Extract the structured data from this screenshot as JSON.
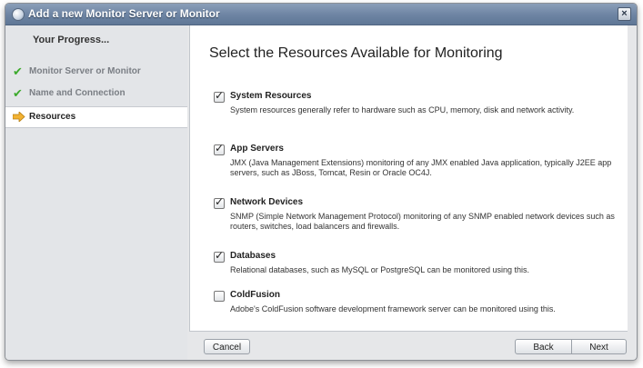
{
  "window": {
    "title": "Add a new Monitor Server or Monitor",
    "close_glyph": "×"
  },
  "sidebar": {
    "heading": "Your Progress...",
    "steps": [
      {
        "label": "Monitor Server or Monitor",
        "state": "done",
        "icon": "checkmark-icon"
      },
      {
        "label": "Name and Connection",
        "state": "done",
        "icon": "checkmark-icon"
      },
      {
        "label": "Resources",
        "state": "current",
        "icon": "arrow-right-icon"
      }
    ]
  },
  "main": {
    "title": "Select the Resources Available for Monitoring",
    "resources": [
      {
        "name": "System Resources",
        "checked": true,
        "description": "System resources generally refer to hardware such as CPU, memory, disk and network activity."
      },
      {
        "name": "App Servers",
        "checked": true,
        "description": "JMX (Java Management Extensions) monitoring of any JMX enabled Java application, typically J2EE app servers, such as JBoss, Tomcat, Resin or Oracle OC4J."
      },
      {
        "name": "Network Devices",
        "checked": true,
        "description": "SNMP (Simple Network Management Protocol) monitoring of any SNMP enabled network devices such as routers, switches, load balancers and firewalls."
      },
      {
        "name": "Databases",
        "checked": true,
        "description": "Relational databases, such as MySQL or PostgreSQL can be monitored using this."
      },
      {
        "name": "ColdFusion",
        "checked": false,
        "description": "Adobe's ColdFusion software development framework server can be monitored using this."
      }
    ]
  },
  "footer": {
    "cancel_label": "Cancel",
    "back_label": "Back",
    "next_label": "Next"
  },
  "colors": {
    "titlebar": "#6d84a3",
    "checkmark": "#3caa2c",
    "current_arrow": "#f2b233"
  }
}
